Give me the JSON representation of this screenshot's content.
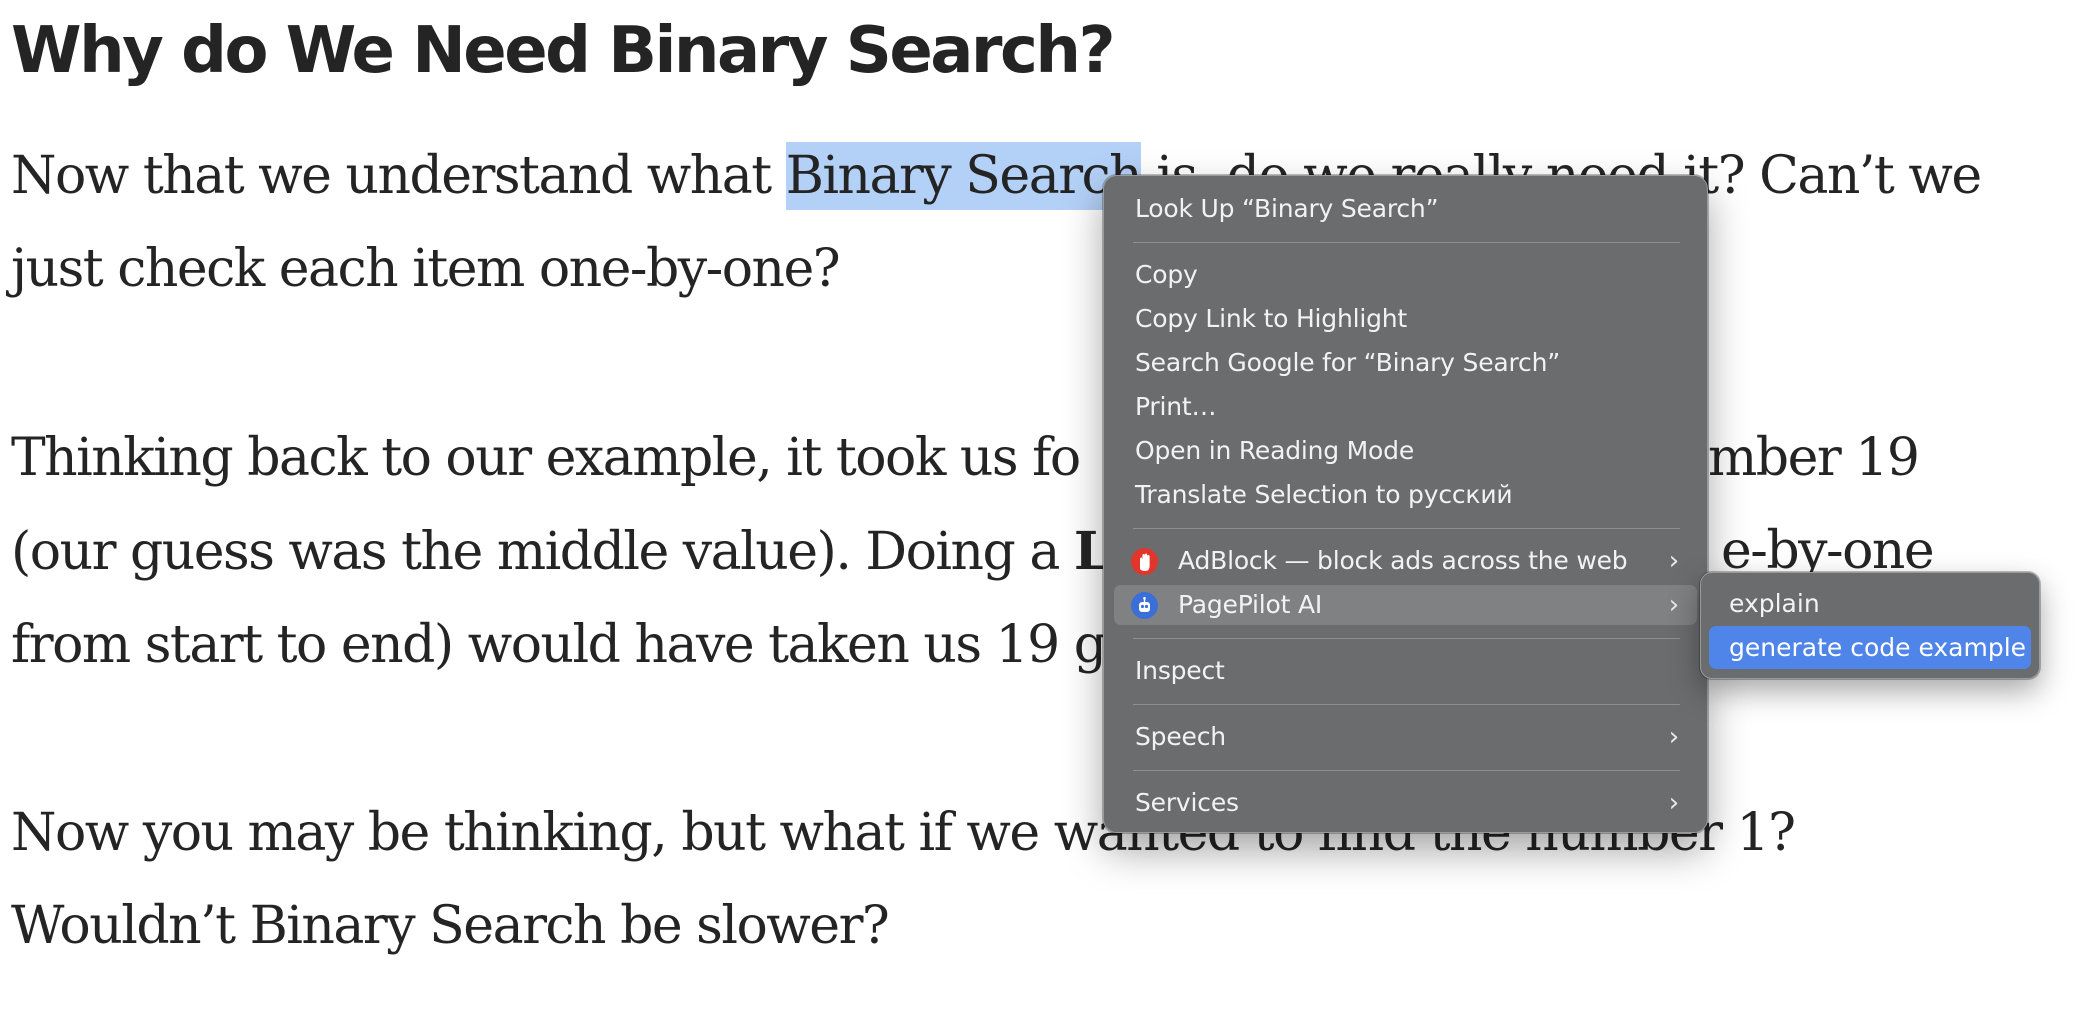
{
  "article": {
    "heading": "Why do We Need Binary Search?",
    "p1": {
      "line1_before": "Now that we understand what ",
      "line1_highlight": "Binary Search",
      "line1_after": " is, do we really need it? Can’t we",
      "line2": "just check each item one-by-one?"
    },
    "p2": {
      "line1_left": "Thinking back to our example, it took us fo",
      "line1_right": "umber 19",
      "line2_left": "(our guess was the middle value). Doing a ",
      "line2_bold": "L",
      "line2_right": "e-by-one",
      "line3_left": "from start to end) would have taken us 19 g"
    },
    "p3": {
      "line1_left": "Now you may be thinking, but what if we wa",
      "line1_right": "nted to find the number 1?",
      "line2": "Wouldn’t Binary Search be slower?"
    }
  },
  "context_menu": {
    "look_up": "Look Up “Binary Search”",
    "copy": "Copy",
    "copy_link": "Copy Link to Highlight",
    "search_google": "Search Google for “Binary Search”",
    "print": "Print…",
    "reading_mode": "Open in Reading Mode",
    "translate": "Translate Selection to русский",
    "adblock": {
      "label": "AdBlock — block ads across the web",
      "icon": "adblock-hand-icon",
      "color": "#e0362b"
    },
    "pagepilot": {
      "label": "PagePilot AI",
      "icon": "pagepilot-robot-icon",
      "color": "#3b6fd8"
    },
    "inspect": "Inspect",
    "speech": "Speech",
    "services": "Services",
    "chevron": "›"
  },
  "submenu": {
    "explain": "explain",
    "generate": "generate code example",
    "active_color": "#4f84e8"
  }
}
